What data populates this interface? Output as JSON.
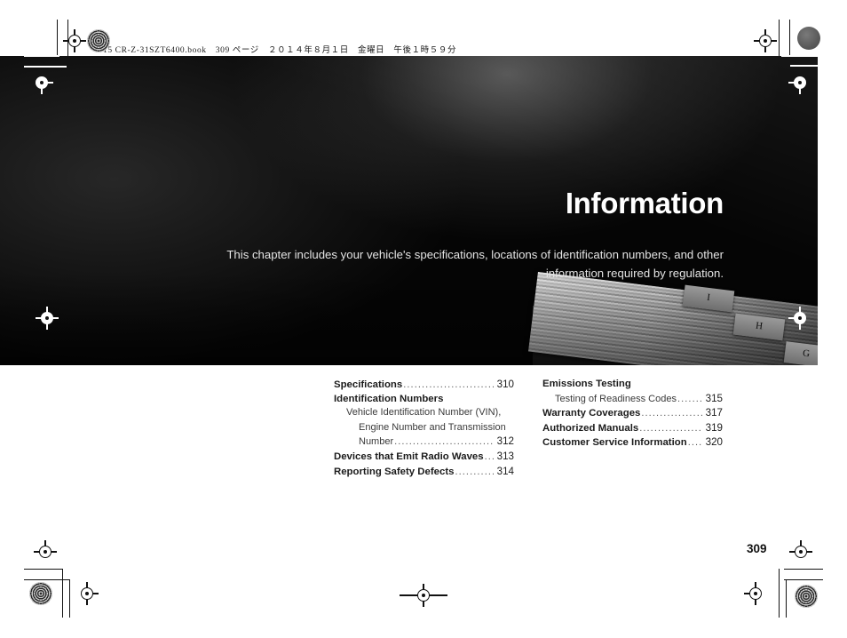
{
  "document": {
    "print_header": "15 CR-Z-31SZT6400.book　309 ページ　２０１４年８月１日　金曜日　午後１時５９分",
    "folio": "309"
  },
  "hero": {
    "title": "Information",
    "subtitle": "This chapter includes your vehicle's specifications, locations of identification numbers, and other information required by regulation.",
    "photo_tabs": [
      {
        "label": "I"
      },
      {
        "label": "H"
      },
      {
        "label": "G"
      }
    ]
  },
  "toc": {
    "left_column": [
      {
        "label": "Specifications",
        "page": "310",
        "level": "top",
        "dots": true
      },
      {
        "label": "Identification Numbers",
        "page": "",
        "level": "top",
        "dots": false
      },
      {
        "label": "Vehicle Identification Number (VIN),",
        "page": "",
        "level": "sub",
        "dots": false
      },
      {
        "label": "Engine Number and Transmission",
        "page": "",
        "level": "wrap",
        "dots": false
      },
      {
        "label": "Number",
        "page": "312",
        "level": "wrapdots",
        "dots": true
      },
      {
        "label": "Devices that Emit Radio Waves",
        "page": "313",
        "level": "top",
        "dots": true
      },
      {
        "label": "Reporting Safety Defects",
        "page": "314",
        "level": "top",
        "dots": true
      }
    ],
    "right_column": [
      {
        "label": "Emissions Testing",
        "page": "",
        "level": "top",
        "dots": false
      },
      {
        "label": "Testing of Readiness Codes",
        "page": "315",
        "level": "sub",
        "dots": true
      },
      {
        "label": "Warranty Coverages",
        "page": "317",
        "level": "top",
        "dots": true
      },
      {
        "label": "Authorized Manuals",
        "page": "319",
        "level": "top",
        "dots": true
      },
      {
        "label": "Customer Service Information",
        "page": "320",
        "level": "top",
        "dots": true
      }
    ]
  },
  "colors": {
    "page_background": "#ffffff",
    "hero_background": "#030303",
    "hero_title": "#ffffff",
    "hero_subtitle": "#e4e4e4",
    "toc_text": "#1b1b1b",
    "toc_sub_text": "#3a3a3a"
  }
}
